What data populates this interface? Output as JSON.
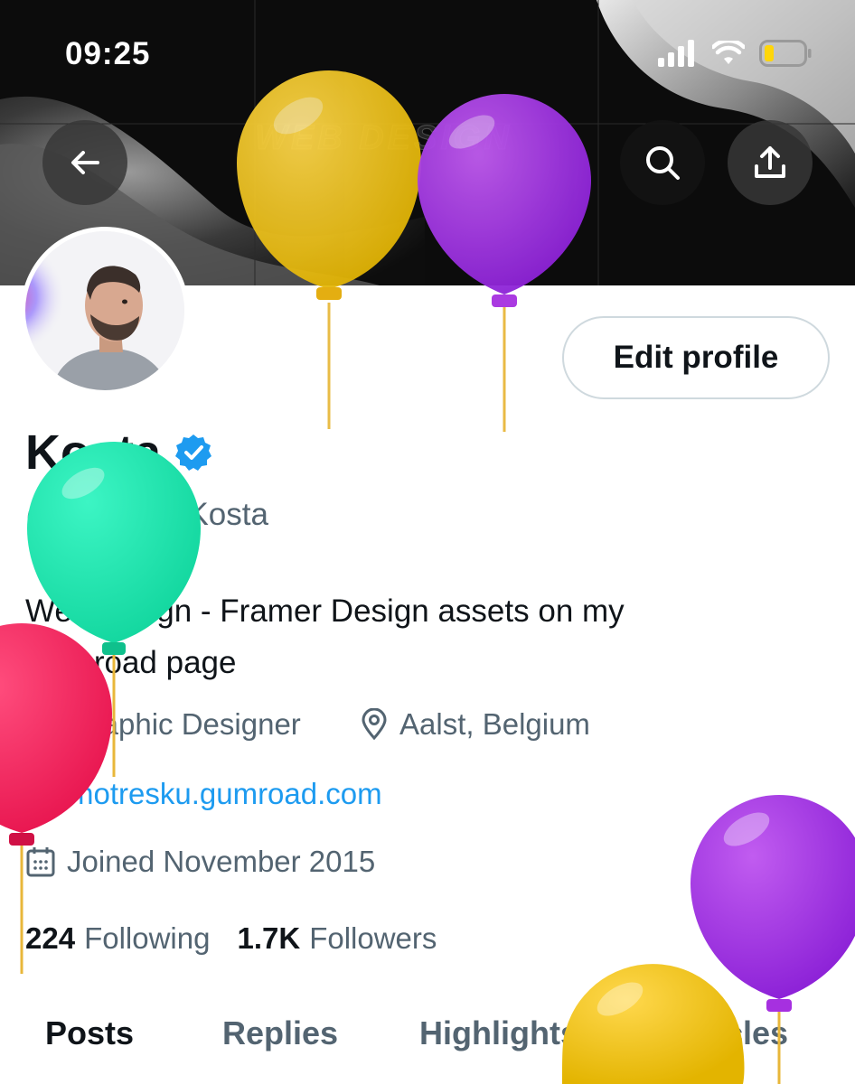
{
  "status_bar": {
    "time": "09:25"
  },
  "banner": {
    "watermark_text": "WEB DESIGN"
  },
  "header_actions": {
    "back_icon": "arrow-left-icon",
    "search_icon": "search-icon",
    "share_icon": "share-icon"
  },
  "profile": {
    "edit_profile_label": "Edit profile",
    "display_name": "Kosta",
    "verified": true,
    "handle": "@MotreskuKosta",
    "bio_line1": "Web design - Framer Design assets on my",
    "bio_line2": "Gumroad page",
    "profession": "Graphic Designer",
    "location": "Aalst, Belgium",
    "website": "motresku.gumroad.com",
    "joined": "Joined November 2015"
  },
  "stats": {
    "following_count": "224",
    "following_label": "Following",
    "followers_count": "1.7K",
    "followers_label": "Followers"
  },
  "tabs": [
    {
      "label": "Posts",
      "active": true
    },
    {
      "label": "Replies",
      "active": false
    },
    {
      "label": "Highlights",
      "active": false
    },
    {
      "label": "Articles",
      "active": false
    }
  ],
  "colors": {
    "accent": "#1d9bf0",
    "text_primary": "#0f1419",
    "text_secondary": "#536471",
    "border": "#cfd9de"
  }
}
